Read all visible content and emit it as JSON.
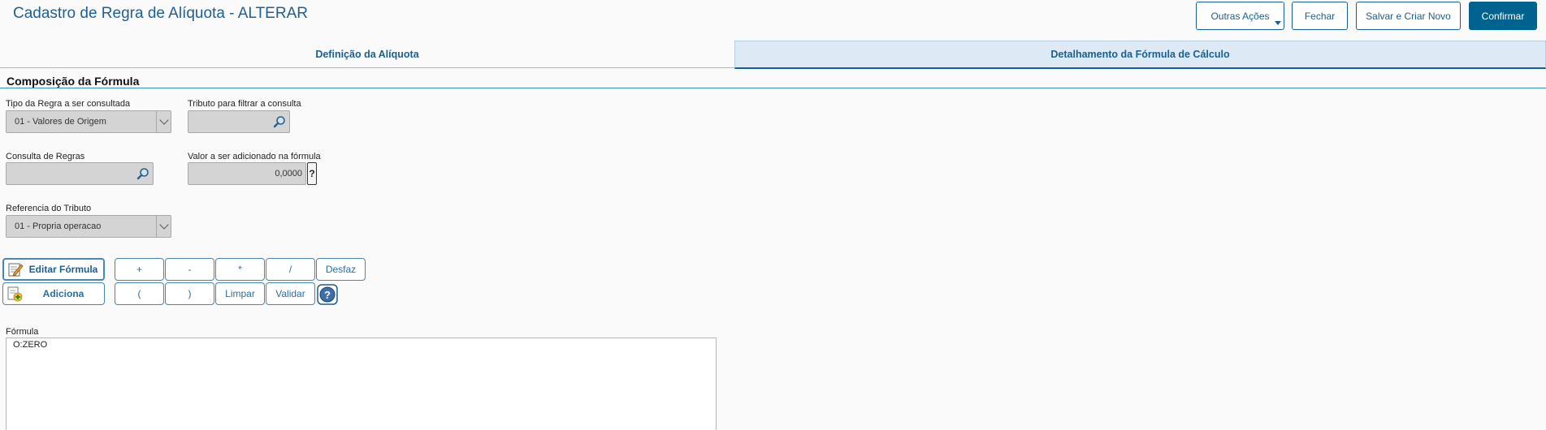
{
  "header": {
    "title": "Cadastro de Regra de Alíquota - ALTERAR",
    "buttons": {
      "outras_acoes": "Outras Ações",
      "fechar": "Fechar",
      "salvar_criar_novo": "Salvar e Criar Novo",
      "confirmar": "Confirmar"
    }
  },
  "tabs": [
    {
      "label": "Definição da Alíquota",
      "active": false
    },
    {
      "label": "Detalhamento da Fórmula de Cálculo",
      "active": true
    }
  ],
  "section": {
    "title": "Composição da Fórmula"
  },
  "fields": {
    "tipo_regra": {
      "label": "Tipo da Regra a ser consultada",
      "value": "01 - Valores de Origem"
    },
    "tributo_filtro": {
      "label": "Tributo para filtrar a consulta",
      "value": ""
    },
    "consulta_regras": {
      "label": "Consulta de Regras",
      "value": ""
    },
    "valor_adicionado": {
      "label": "Valor a ser adicionado na fórmula",
      "value": "0,0000",
      "help": "?"
    },
    "referencia_tributo": {
      "label": "Referencia do Tributo",
      "value": "01 - Propria operacao"
    }
  },
  "formula_buttons": {
    "editar": "Editar Fórmula",
    "adiciona": "Adiciona",
    "plus": "+",
    "minus": "-",
    "times": "*",
    "divide": "/",
    "desfaz": "Desfaz",
    "open_paren": "(",
    "close_paren": ")",
    "limpar": "Limpar",
    "validar": "Validar"
  },
  "formula": {
    "label": "Fórmula",
    "value": "O:ZERO"
  },
  "colors": {
    "accent": "#00628f",
    "title": "#1e5f96",
    "tab_active_bg": "#dde9f5"
  }
}
